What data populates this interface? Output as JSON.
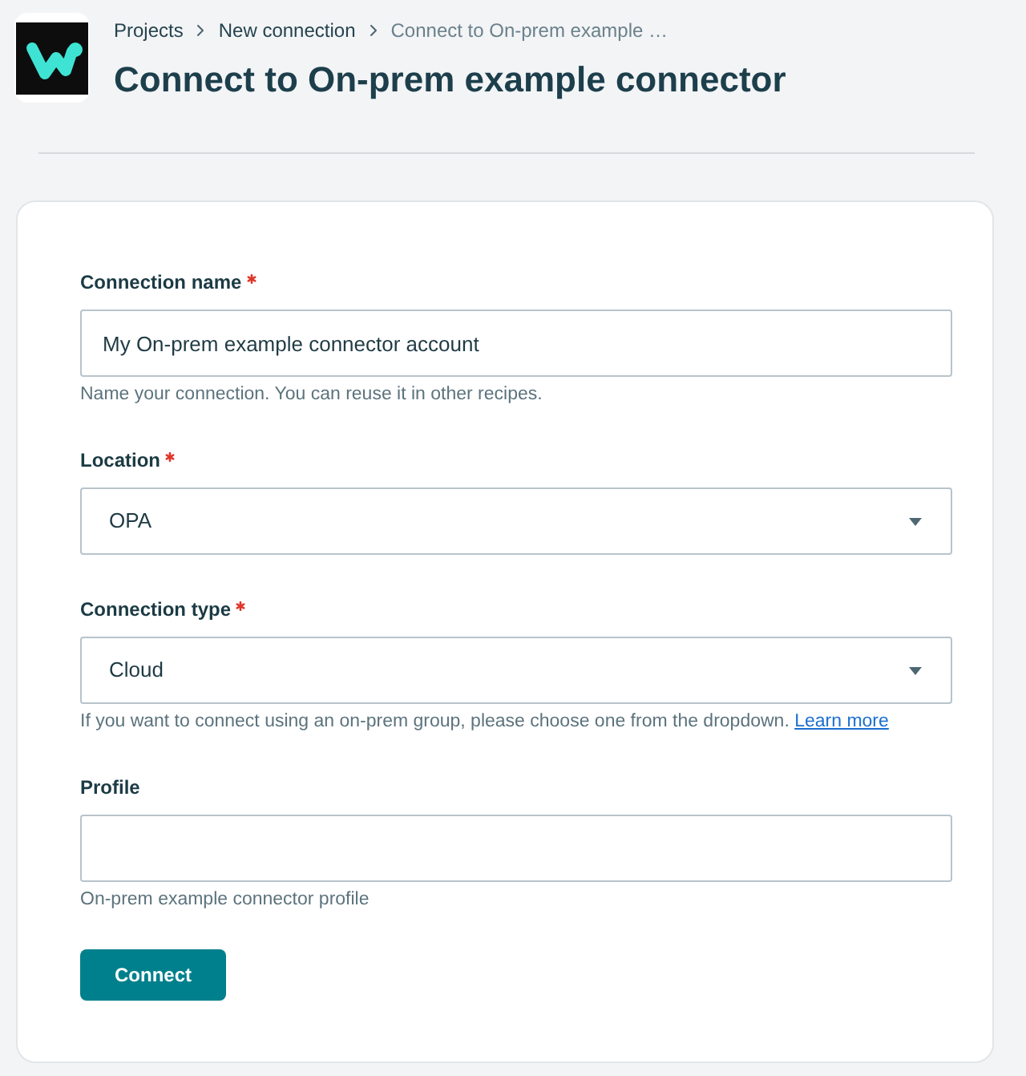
{
  "breadcrumb": [
    {
      "label": "Projects",
      "current": false
    },
    {
      "label": "New connection",
      "current": false
    },
    {
      "label": "Connect to On-prem example …",
      "current": true
    }
  ],
  "title": "Connect to On-prem example connector",
  "form": {
    "fields": [
      {
        "kind": "text",
        "label": "Connection name",
        "required": true,
        "value": "My On-prem example connector account",
        "help": "Name your connection. You can reuse it in other recipes."
      },
      {
        "kind": "select",
        "label": "Location",
        "required": true,
        "value": "OPA"
      },
      {
        "kind": "select",
        "label": "Connection type",
        "required": true,
        "value": "Cloud",
        "help": "If you want to connect using an on-prem group, please choose one from the dropdown.",
        "help_link": "Learn more"
      },
      {
        "kind": "text",
        "label": "Profile",
        "required": false,
        "help": "On-prem example connector profile"
      }
    ],
    "submit": "Connect"
  }
}
